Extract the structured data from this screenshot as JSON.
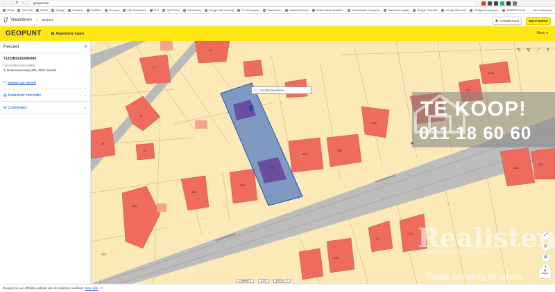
{
  "browser": {
    "url": "geopunt.be",
    "bookmarks": [
      "Gmail",
      "YouTube",
      "Netflix",
      "Spotify",
      "Cadeaus",
      "CadiStar",
      "Geopunt",
      "Mijn Notarissen",
      "IWT",
      "My Events",
      "Weltweit.kp",
      "Google Afb Verkoop",
      "Fb Verkoopers",
      "Vlaanderen",
      "Kadaster/Finder",
      "Bodemattest bestellen",
      "Nederlandse verkopers",
      "Nationaal register",
      "Design Template",
      "Google Microsoft",
      "Vastgoed verkopers",
      "WINDESCOOP",
      "Alle bookmarks"
    ],
    "extension_colors": [
      "#d33",
      "#555",
      "#444",
      "#2a7",
      "#333",
      "#777"
    ]
  },
  "header": {
    "brand": "Vlaanderen",
    "sub": "geopunt",
    "login": "AANMELDEN",
    "help": "HULP NODIG"
  },
  "appbar": {
    "logo": "GEOPUNT",
    "map_name": "Algemene kaart",
    "menu": "Menu"
  },
  "panel": {
    "title": "Perceel",
    "parcel_id": "71322B0226/00F004",
    "address_label": "Dichtstbijzijnd adres",
    "address": "Genkersteenweg 390, 3500 Hasselt",
    "link": "Website van Hasselt",
    "accordions": [
      "Kadastrale informatie",
      "Coördinaten"
    ]
  },
  "map": {
    "popup_label": "71322B0226/00F004",
    "street_1": "Genkersteenweg",
    "street_2": "Genkersteenweg",
    "legend": "Legen",
    "scale_items": [
      "Lambert72",
      "1:1/4",
      "4000 m ≈ 1"
    ],
    "house_labels": [
      {
        "text": "23"
      },
      {
        "text": "27"
      },
      {
        "text": "15"
      },
      {
        "text": "17"
      },
      {
        "text": "19"
      },
      {
        "text": "386"
      },
      {
        "text": "388"
      },
      {
        "text": "392"
      },
      {
        "text": "394"
      },
      {
        "text": "396"
      },
      {
        "text": "398"
      },
      {
        "text": "404"
      },
      {
        "text": "404A"
      },
      {
        "text": "406"
      },
      {
        "text": "402"
      },
      {
        "text": "382"
      },
      {
        "text": "378"
      },
      {
        "text": "411"
      },
      {
        "text": "413"
      },
      {
        "text": "415"
      },
      {
        "text": "390"
      }
    ]
  },
  "ad": {
    "title": "TE KOOP!",
    "phone": "011 18 60 60",
    "brand": "Realisten",
    "tagline": "Makelaars met een hart",
    "sub": "Gratis schatting én advies"
  },
  "footer": {
    "text": "Geopunt is een officiële website van de Vlaamse overheid",
    "link": "Meer info"
  },
  "colors": {
    "parcel_fill": "#fbeab8",
    "building": "#ee6b5d",
    "road": "#b9b9b9",
    "selection": "#3b6fc9",
    "yellow": "#ffe615"
  }
}
